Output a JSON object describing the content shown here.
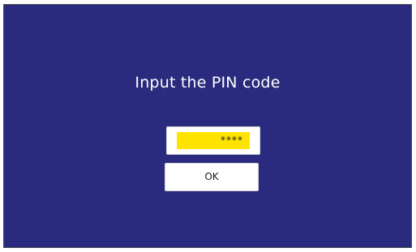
{
  "dialog": {
    "title": "Input the PIN code",
    "pin_value": "****",
    "ok_label": "OK"
  },
  "colors": {
    "background": "#2a2b7e",
    "pin_highlight": "#ffe400"
  }
}
